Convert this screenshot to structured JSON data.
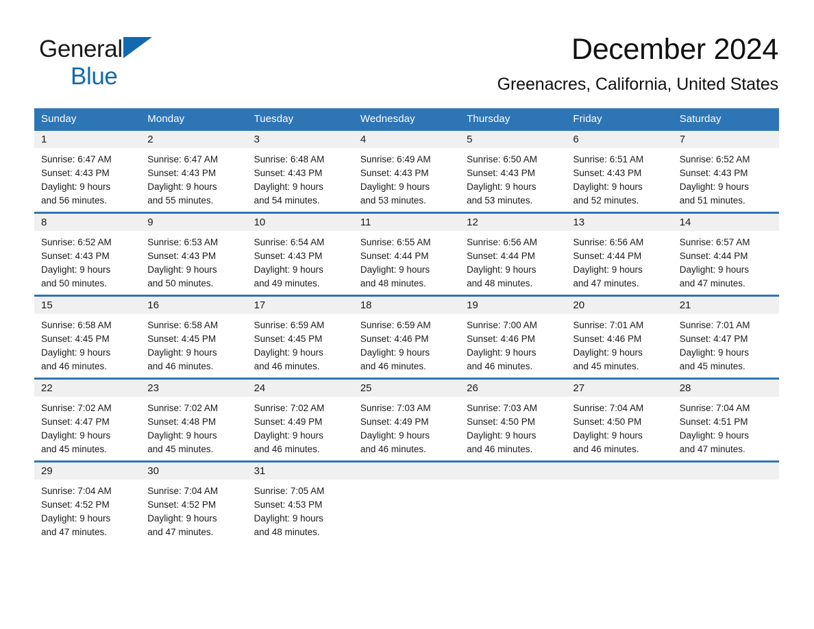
{
  "brand": {
    "word1": "General",
    "word2": "Blue",
    "triangle_color": "#1269b0",
    "text_color": "#1a1a1a"
  },
  "header": {
    "title": "December 2024",
    "location": "Greenacres, California, United States"
  },
  "theme": {
    "header_blue": "#2e75b6",
    "row_rule_blue": "#2e75b6",
    "daynum_band": "#f0f0f0",
    "page_background": "#ffffff",
    "text": "#1a1a1a"
  },
  "weekdays": [
    "Sunday",
    "Monday",
    "Tuesday",
    "Wednesday",
    "Thursday",
    "Friday",
    "Saturday"
  ],
  "weeks": [
    [
      {
        "day": "1",
        "sunrise": "Sunrise: 6:47 AM",
        "sunset": "Sunset: 4:43 PM",
        "daylight1": "Daylight: 9 hours",
        "daylight2": "and 56 minutes."
      },
      {
        "day": "2",
        "sunrise": "Sunrise: 6:47 AM",
        "sunset": "Sunset: 4:43 PM",
        "daylight1": "Daylight: 9 hours",
        "daylight2": "and 55 minutes."
      },
      {
        "day": "3",
        "sunrise": "Sunrise: 6:48 AM",
        "sunset": "Sunset: 4:43 PM",
        "daylight1": "Daylight: 9 hours",
        "daylight2": "and 54 minutes."
      },
      {
        "day": "4",
        "sunrise": "Sunrise: 6:49 AM",
        "sunset": "Sunset: 4:43 PM",
        "daylight1": "Daylight: 9 hours",
        "daylight2": "and 53 minutes."
      },
      {
        "day": "5",
        "sunrise": "Sunrise: 6:50 AM",
        "sunset": "Sunset: 4:43 PM",
        "daylight1": "Daylight: 9 hours",
        "daylight2": "and 53 minutes."
      },
      {
        "day": "6",
        "sunrise": "Sunrise: 6:51 AM",
        "sunset": "Sunset: 4:43 PM",
        "daylight1": "Daylight: 9 hours",
        "daylight2": "and 52 minutes."
      },
      {
        "day": "7",
        "sunrise": "Sunrise: 6:52 AM",
        "sunset": "Sunset: 4:43 PM",
        "daylight1": "Daylight: 9 hours",
        "daylight2": "and 51 minutes."
      }
    ],
    [
      {
        "day": "8",
        "sunrise": "Sunrise: 6:52 AM",
        "sunset": "Sunset: 4:43 PM",
        "daylight1": "Daylight: 9 hours",
        "daylight2": "and 50 minutes."
      },
      {
        "day": "9",
        "sunrise": "Sunrise: 6:53 AM",
        "sunset": "Sunset: 4:43 PM",
        "daylight1": "Daylight: 9 hours",
        "daylight2": "and 50 minutes."
      },
      {
        "day": "10",
        "sunrise": "Sunrise: 6:54 AM",
        "sunset": "Sunset: 4:43 PM",
        "daylight1": "Daylight: 9 hours",
        "daylight2": "and 49 minutes."
      },
      {
        "day": "11",
        "sunrise": "Sunrise: 6:55 AM",
        "sunset": "Sunset: 4:44 PM",
        "daylight1": "Daylight: 9 hours",
        "daylight2": "and 48 minutes."
      },
      {
        "day": "12",
        "sunrise": "Sunrise: 6:56 AM",
        "sunset": "Sunset: 4:44 PM",
        "daylight1": "Daylight: 9 hours",
        "daylight2": "and 48 minutes."
      },
      {
        "day": "13",
        "sunrise": "Sunrise: 6:56 AM",
        "sunset": "Sunset: 4:44 PM",
        "daylight1": "Daylight: 9 hours",
        "daylight2": "and 47 minutes."
      },
      {
        "day": "14",
        "sunrise": "Sunrise: 6:57 AM",
        "sunset": "Sunset: 4:44 PM",
        "daylight1": "Daylight: 9 hours",
        "daylight2": "and 47 minutes."
      }
    ],
    [
      {
        "day": "15",
        "sunrise": "Sunrise: 6:58 AM",
        "sunset": "Sunset: 4:45 PM",
        "daylight1": "Daylight: 9 hours",
        "daylight2": "and 46 minutes."
      },
      {
        "day": "16",
        "sunrise": "Sunrise: 6:58 AM",
        "sunset": "Sunset: 4:45 PM",
        "daylight1": "Daylight: 9 hours",
        "daylight2": "and 46 minutes."
      },
      {
        "day": "17",
        "sunrise": "Sunrise: 6:59 AM",
        "sunset": "Sunset: 4:45 PM",
        "daylight1": "Daylight: 9 hours",
        "daylight2": "and 46 minutes."
      },
      {
        "day": "18",
        "sunrise": "Sunrise: 6:59 AM",
        "sunset": "Sunset: 4:46 PM",
        "daylight1": "Daylight: 9 hours",
        "daylight2": "and 46 minutes."
      },
      {
        "day": "19",
        "sunrise": "Sunrise: 7:00 AM",
        "sunset": "Sunset: 4:46 PM",
        "daylight1": "Daylight: 9 hours",
        "daylight2": "and 46 minutes."
      },
      {
        "day": "20",
        "sunrise": "Sunrise: 7:01 AM",
        "sunset": "Sunset: 4:46 PM",
        "daylight1": "Daylight: 9 hours",
        "daylight2": "and 45 minutes."
      },
      {
        "day": "21",
        "sunrise": "Sunrise: 7:01 AM",
        "sunset": "Sunset: 4:47 PM",
        "daylight1": "Daylight: 9 hours",
        "daylight2": "and 45 minutes."
      }
    ],
    [
      {
        "day": "22",
        "sunrise": "Sunrise: 7:02 AM",
        "sunset": "Sunset: 4:47 PM",
        "daylight1": "Daylight: 9 hours",
        "daylight2": "and 45 minutes."
      },
      {
        "day": "23",
        "sunrise": "Sunrise: 7:02 AM",
        "sunset": "Sunset: 4:48 PM",
        "daylight1": "Daylight: 9 hours",
        "daylight2": "and 45 minutes."
      },
      {
        "day": "24",
        "sunrise": "Sunrise: 7:02 AM",
        "sunset": "Sunset: 4:49 PM",
        "daylight1": "Daylight: 9 hours",
        "daylight2": "and 46 minutes."
      },
      {
        "day": "25",
        "sunrise": "Sunrise: 7:03 AM",
        "sunset": "Sunset: 4:49 PM",
        "daylight1": "Daylight: 9 hours",
        "daylight2": "and 46 minutes."
      },
      {
        "day": "26",
        "sunrise": "Sunrise: 7:03 AM",
        "sunset": "Sunset: 4:50 PM",
        "daylight1": "Daylight: 9 hours",
        "daylight2": "and 46 minutes."
      },
      {
        "day": "27",
        "sunrise": "Sunrise: 7:04 AM",
        "sunset": "Sunset: 4:50 PM",
        "daylight1": "Daylight: 9 hours",
        "daylight2": "and 46 minutes."
      },
      {
        "day": "28",
        "sunrise": "Sunrise: 7:04 AM",
        "sunset": "Sunset: 4:51 PM",
        "daylight1": "Daylight: 9 hours",
        "daylight2": "and 47 minutes."
      }
    ],
    [
      {
        "day": "29",
        "sunrise": "Sunrise: 7:04 AM",
        "sunset": "Sunset: 4:52 PM",
        "daylight1": "Daylight: 9 hours",
        "daylight2": "and 47 minutes."
      },
      {
        "day": "30",
        "sunrise": "Sunrise: 7:04 AM",
        "sunset": "Sunset: 4:52 PM",
        "daylight1": "Daylight: 9 hours",
        "daylight2": "and 47 minutes."
      },
      {
        "day": "31",
        "sunrise": "Sunrise: 7:05 AM",
        "sunset": "Sunset: 4:53 PM",
        "daylight1": "Daylight: 9 hours",
        "daylight2": "and 48 minutes."
      },
      {
        "day": "",
        "sunrise": "",
        "sunset": "",
        "daylight1": "",
        "daylight2": ""
      },
      {
        "day": "",
        "sunrise": "",
        "sunset": "",
        "daylight1": "",
        "daylight2": ""
      },
      {
        "day": "",
        "sunrise": "",
        "sunset": "",
        "daylight1": "",
        "daylight2": ""
      },
      {
        "day": "",
        "sunrise": "",
        "sunset": "",
        "daylight1": "",
        "daylight2": ""
      }
    ]
  ]
}
